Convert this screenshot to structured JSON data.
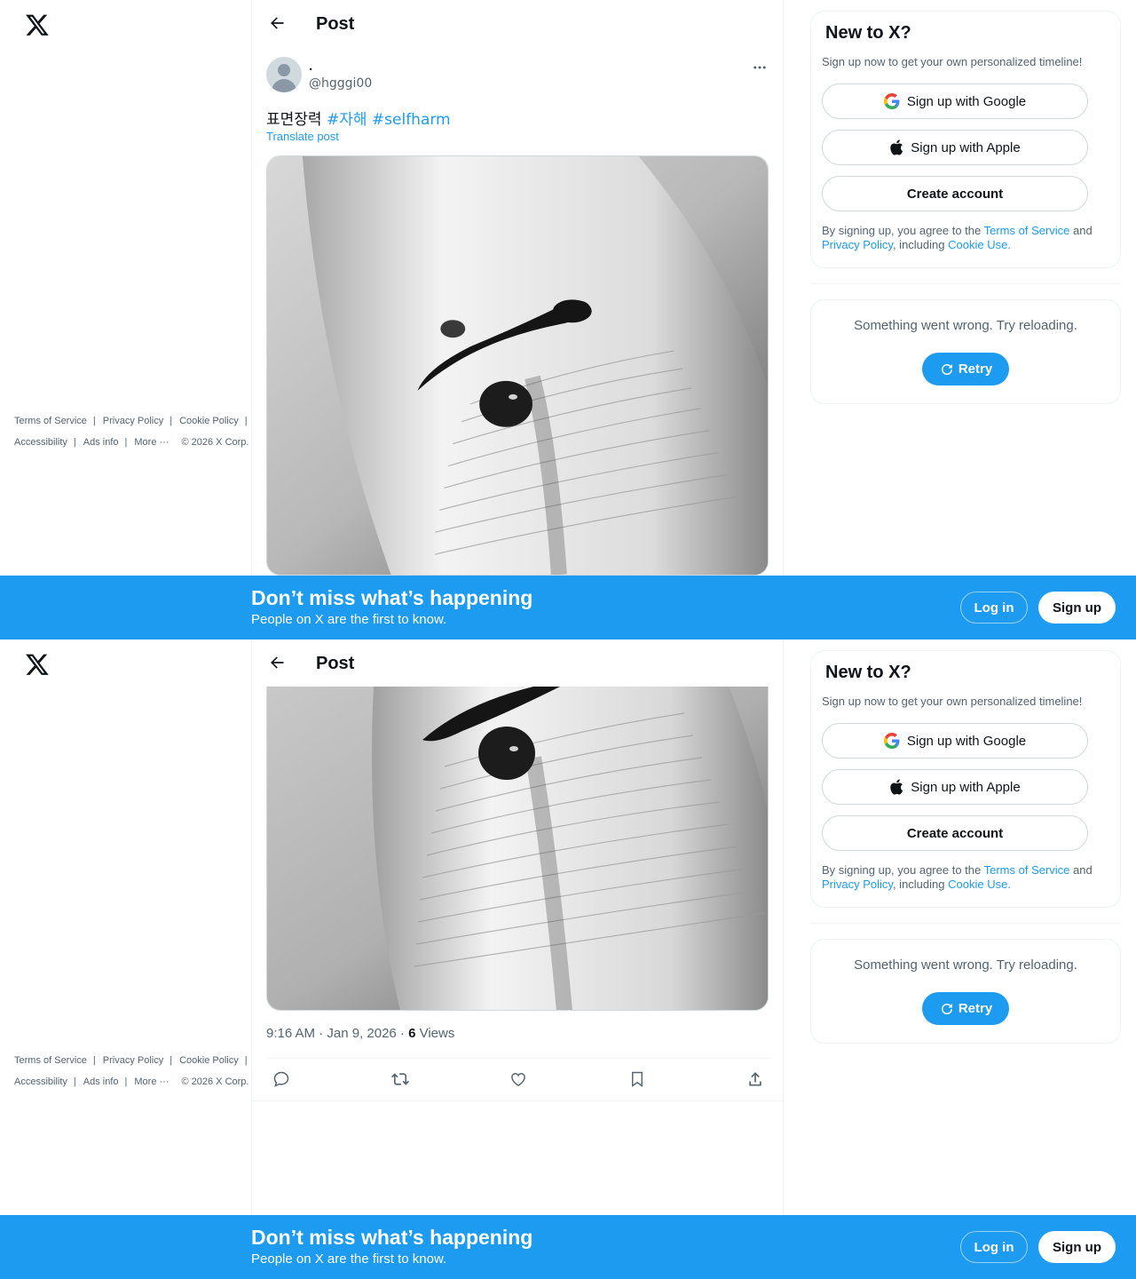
{
  "nav": {
    "logo": "x-logo-icon"
  },
  "header": {
    "title": "Post",
    "back_icon": "back-arrow-icon"
  },
  "post": {
    "display_name": ".",
    "handle": "@hgggi00",
    "text": "표면장력 ",
    "hashtags": [
      "#자해",
      "#selfharm"
    ],
    "translate_label": "Translate post",
    "timestamp": "9:16 AM · Jan 9, 2026 · ",
    "views_count": "6",
    "views_label": " Views",
    "actions": [
      "reply-icon",
      "repost-icon",
      "like-icon",
      "bookmark-icon",
      "share-icon"
    ]
  },
  "sidebar": {
    "signup_card": {
      "title": "New to X?",
      "subtitle": "Sign up now to get your own personalized timeline!",
      "google_label": "Sign up with Google",
      "apple_label": "Sign up with Apple",
      "create_label": "Create account",
      "legal_prefix": "By signing up, you agree to the ",
      "tos": "Terms of Service",
      "and": " and ",
      "privacy": "Privacy Policy",
      "including": ", including ",
      "cookie": "Cookie Use."
    },
    "error_card": {
      "message": "Something went wrong. Try reloading.",
      "retry_label": "Retry"
    },
    "footer": {
      "terms": "Terms of Service",
      "privacy": "Privacy Policy",
      "cookie": "Cookie Policy",
      "accessibility": "Accessibility",
      "ads": "Ads info",
      "more": "More ···",
      "copyright": "© 2026 X Corp."
    }
  },
  "banner": {
    "title": "Don’t miss what’s happening",
    "subtitle": "People on X are the first to know.",
    "login_label": "Log in",
    "signup_label": "Sign up"
  },
  "colors": {
    "accent": "#1d9bf0",
    "text": "#0f1419",
    "muted": "#536471",
    "border": "#eff3f4"
  }
}
